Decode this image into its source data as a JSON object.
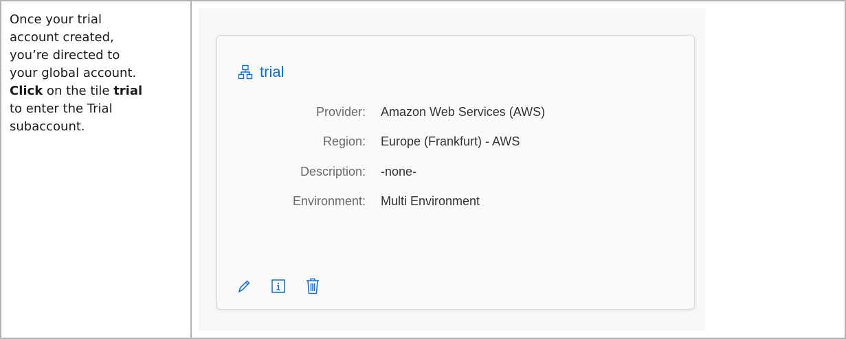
{
  "instruction": {
    "line1": "Once your trial",
    "line2": "account created,",
    "line3": "you’re directed to",
    "line4": "your global account.",
    "click_word": "Click",
    "line5_rest": " on the tile ",
    "trial_word": "trial",
    "line6": "to enter the Trial",
    "line7": "subaccount."
  },
  "tile": {
    "icon": "hierarchy-icon",
    "title": "trial",
    "properties": [
      {
        "key": "Provider:",
        "value": "Amazon Web Services (AWS)"
      },
      {
        "key": "Region:",
        "value": "Europe (Frankfurt) - AWS"
      },
      {
        "key": "Description:",
        "value": "-none-"
      },
      {
        "key": "Environment:",
        "value": "Multi Environment"
      }
    ],
    "actions": [
      {
        "name": "edit",
        "icon": "pencil-icon"
      },
      {
        "name": "info",
        "icon": "info-icon"
      },
      {
        "name": "delete",
        "icon": "trash-icon"
      }
    ]
  },
  "colors": {
    "accent": "#0a6ed1",
    "label": "#6a6a6a",
    "value": "#333333",
    "border": "#b3b3b3"
  }
}
